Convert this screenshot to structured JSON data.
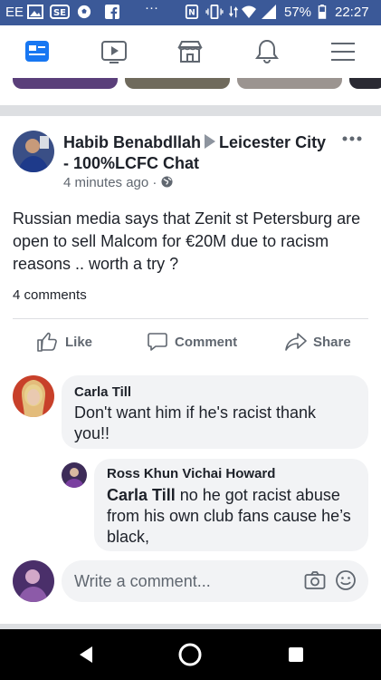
{
  "status_bar": {
    "carrier": "EE",
    "battery": "57%",
    "time": "22:27",
    "bar_color": "#3b5998"
  },
  "nav": {
    "items": [
      {
        "name": "news-feed",
        "icon": "news-feed-icon",
        "active": true
      },
      {
        "name": "watch",
        "icon": "video-play-icon"
      },
      {
        "name": "marketplace",
        "icon": "storefront-icon"
      },
      {
        "name": "notifications",
        "icon": "bell-icon"
      },
      {
        "name": "menu",
        "icon": "hamburger-menu-icon"
      }
    ],
    "active_color": "#1877f2"
  },
  "post": {
    "author": "Habib Benabdllah",
    "group": "Leicester City - 100%LCFC Chat",
    "time": "4 minutes ago",
    "privacy_icon": "globe-icon",
    "text": "Russian media says that Zenit st Petersburg are open to sell Malcom for €20M due to racism reasons .. worth a try ?",
    "comment_count": "4 comments",
    "actions": {
      "like": "Like",
      "comment": "Comment",
      "share": "Share"
    }
  },
  "comments": [
    {
      "author": "Carla Till",
      "text": "Don't want him if he's racist thank you!!"
    },
    {
      "author": "Ross Khun Vichai Howard",
      "mention": "Carla Till",
      "text": "no he got racist abuse from his own club fans cause he’s black,"
    }
  ],
  "composer": {
    "placeholder": "Write a comment..."
  }
}
